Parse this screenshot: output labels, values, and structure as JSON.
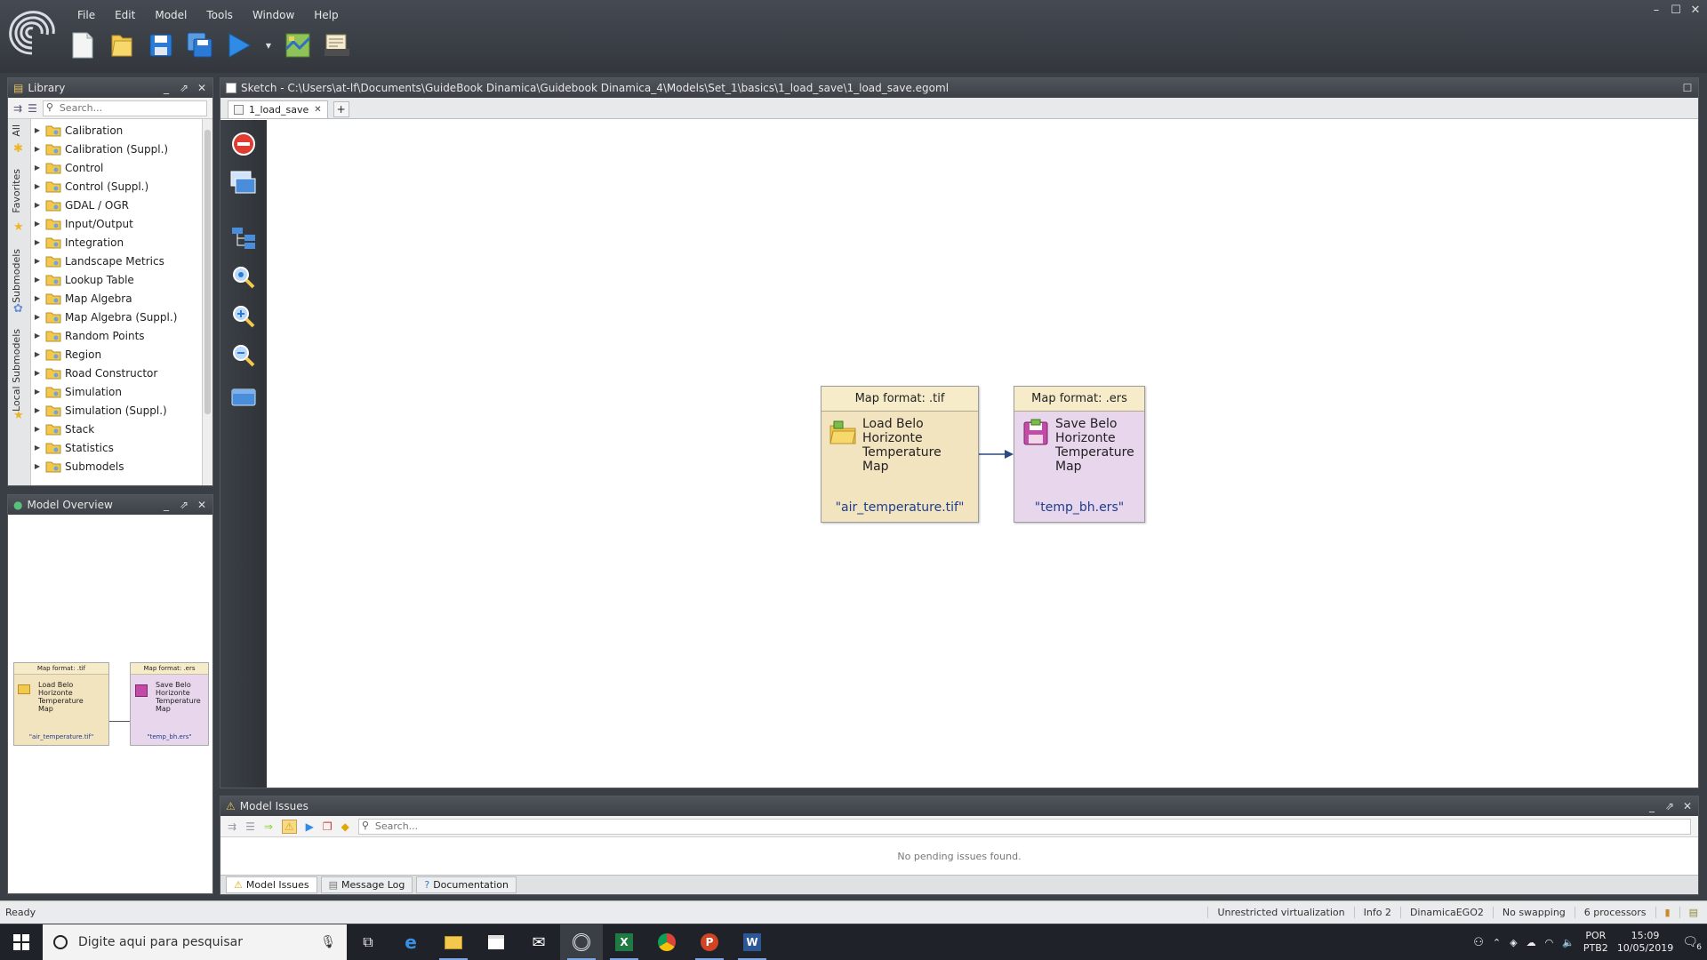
{
  "menu": [
    "File",
    "Edit",
    "Model",
    "Tools",
    "Window",
    "Help"
  ],
  "window_controls": [
    "–",
    "☐",
    "✕"
  ],
  "library": {
    "title": "Library",
    "search_placeholder": "Search...",
    "vertical_tabs": [
      "All",
      "Favorites",
      "Submodels",
      "Local Submodels"
    ],
    "items": [
      "Calibration",
      "Calibration (Suppl.)",
      "Control",
      "Control (Suppl.)",
      "GDAL / OGR",
      "Input/Output",
      "Integration",
      "Landscape Metrics",
      "Lookup Table",
      "Map Algebra",
      "Map Algebra (Suppl.)",
      "Random Points",
      "Region",
      "Road Constructor",
      "Simulation",
      "Simulation (Suppl.)",
      "Stack",
      "Statistics",
      "Submodels"
    ]
  },
  "overview": {
    "title": "Model Overview",
    "nodes": [
      {
        "header": "Map format: .tif",
        "name": "Load Belo Horizonte Temperature Map",
        "value": "\"air_temperature.tif\""
      },
      {
        "header": "Map format: .ers",
        "name": "Save Belo Horizonte Temperature Map",
        "value": "\"temp_bh.ers\""
      }
    ]
  },
  "sketch": {
    "title": "Sketch - C:\\Users\\at-lf\\Documents\\GuideBook Dinamica\\Guidebook Dinamica_4\\Models\\Set_1\\basics\\1_load_save\\1_load_save.egoml",
    "tab_label": "1_load_save",
    "nodes": [
      {
        "header": "Map format: .tif",
        "name_lines": [
          "Load Belo",
          "Horizonte",
          "Temperature",
          "Map"
        ],
        "value": "\"air_temperature.tif\"",
        "color": "#f3e4c0",
        "header_color": "#f7ecc9"
      },
      {
        "header": "Map format: .ers",
        "name_lines": [
          "Save Belo",
          "Horizonte",
          "Temperature",
          "Map"
        ],
        "value": "\"temp_bh.ers\"",
        "color": "#e8d6ec",
        "header_color": "#f7ecc9"
      }
    ]
  },
  "issues": {
    "title": "Model Issues",
    "search_placeholder": "Search...",
    "message": "No pending issues found.",
    "tabs": [
      "Model Issues",
      "Message Log",
      "Documentation"
    ]
  },
  "status": {
    "left": "Ready",
    "items": [
      "Unrestricted virtualization",
      "Info 2",
      "DinamicaEGO2",
      "No swapping",
      "6 processors"
    ]
  },
  "taskbar": {
    "search_placeholder": "Digite aqui para pesquisar",
    "lang": [
      "POR",
      "PTB2"
    ],
    "time": "15:09",
    "date": "10/05/2019",
    "notifications": "6"
  },
  "colors": {
    "accent": "#1f6fc4",
    "node_load": "#f3e4c0",
    "node_save": "#e8d6ec",
    "link": "#1d3d8f"
  }
}
